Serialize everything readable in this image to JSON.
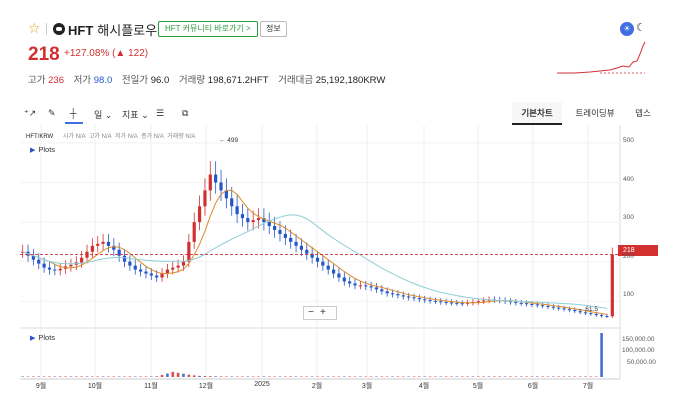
{
  "header": {
    "coin_symbol": "HFT",
    "coin_name": "해시플로우",
    "community_label": "HFT 커뮤니티 바로가기 >",
    "info_label": "정보",
    "price": "218",
    "change_text": "+127.08% (▲ 122)",
    "stats": [
      {
        "label": "고가",
        "value": "236"
      },
      {
        "label": "저가",
        "value": "98.0"
      },
      {
        "label": "전일가",
        "value": "96.0"
      },
      {
        "label": "거래량",
        "value": "198,671.2",
        "unit": "HFT"
      },
      {
        "label": "거래대금",
        "value": "25,192,180",
        "unit": "KRW"
      }
    ]
  },
  "toolbar": {
    "period_label": "일",
    "indicator_label": "지표",
    "tabs": [
      "기본차트",
      "트레이딩뷰",
      "뎁스"
    ],
    "active_tab": "기본차트"
  },
  "legend": {
    "pair": "HFT/KRW",
    "items": [
      "시가 N/A",
      "고가 N/A",
      "저가 N/A",
      "종가 N/A",
      "거래량 N/A"
    ]
  },
  "plots_label": "Plots",
  "colors": {
    "up": "#d23030",
    "down": "#2456c8",
    "ma_short": "#e08a2a",
    "ma_long": "#8ccfd6"
  },
  "chart_data": {
    "type": "candlestick",
    "x_ticks": [
      "9월",
      "10월",
      "11월",
      "12월",
      "2025",
      "2월",
      "3월",
      "4월",
      "5월",
      "6월",
      "7월"
    ],
    "y_ticks": [
      "500",
      "400",
      "300",
      "200",
      "100"
    ],
    "volume_ticks": [
      "150,000.00",
      "100,000.00",
      "50,000.00"
    ],
    "current_price_label": "218",
    "annotations": [
      "← 499",
      "← 61.5"
    ],
    "price_series": [
      225,
      215,
      205,
      195,
      185,
      180,
      178,
      182,
      188,
      192,
      198,
      210,
      225,
      240,
      245,
      250,
      240,
      230,
      215,
      200,
      190,
      180,
      175,
      170,
      165,
      160,
      170,
      180,
      185,
      190,
      200,
      250,
      300,
      340,
      380,
      420,
      400,
      380,
      360,
      340,
      320,
      310,
      300,
      305,
      310,
      300,
      290,
      280,
      270,
      260,
      250,
      240,
      230,
      220,
      210,
      200,
      190,
      180,
      170,
      160,
      150,
      145,
      140,
      140,
      138,
      135,
      130,
      125,
      120,
      118,
      115,
      112,
      110,
      108,
      105,
      103,
      101,
      100,
      98,
      97,
      96,
      95,
      94,
      96,
      98,
      100,
      102,
      104,
      103,
      102,
      100,
      98,
      96,
      95,
      93,
      92,
      90,
      88,
      86,
      84,
      82,
      80,
      78,
      75,
      72,
      70,
      68,
      65,
      63,
      62,
      218
    ],
    "volume_series": [
      800,
      600,
      500,
      900,
      400,
      300,
      200,
      400,
      600,
      900,
      1200,
      800,
      1000,
      1500,
      1800,
      2000,
      1200,
      900,
      700,
      500,
      400,
      300,
      400,
      800,
      1200,
      3000,
      9000,
      15000,
      22000,
      18000,
      14000,
      10000,
      7000,
      5000,
      4000,
      3500,
      3000,
      2500,
      2000,
      1800,
      1500,
      1200,
      1000,
      900,
      800,
      700,
      900,
      1200,
      1600,
      2200,
      2600,
      2000,
      1500,
      1100,
      900,
      700,
      600,
      500,
      500,
      450,
      400,
      420,
      380,
      360,
      340,
      320,
      300,
      300,
      320,
      340,
      360,
      380,
      400,
      380,
      360,
      340,
      320,
      300,
      290,
      280,
      270,
      260,
      250,
      240,
      230,
      220,
      210,
      200,
      190,
      180,
      170,
      160,
      155,
      150,
      145,
      140,
      135,
      130,
      128,
      126,
      124,
      122,
      120,
      118,
      116,
      114,
      112,
      110,
      190000
    ]
  }
}
